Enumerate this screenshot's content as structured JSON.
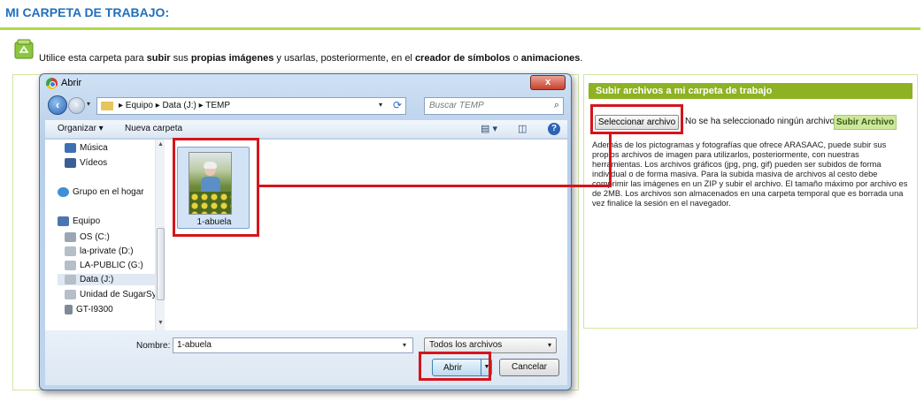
{
  "page": {
    "title": "MI CARPETA DE TRABAJO:",
    "intro": {
      "t1": "Utilice esta carpeta para ",
      "b1": "subir",
      "t2": " sus ",
      "b2": "propias imágenes",
      "t3": " y usarlas, posteriormente, en el ",
      "b3": "creador de símbolos",
      "t4": " o ",
      "b4": "animaciones",
      "t5": "."
    }
  },
  "upload_panel": {
    "header": "Subir archivos a mi carpeta de trabajo",
    "select_button": "Seleccionar archivo",
    "no_file_text": "No se ha seleccionado ningún archivo",
    "upload_button": "Subir Archivo",
    "description": "Además de los pictogramas y fotografías que ofrece ARASAAC, puede subir sus propios archivos de imagen para utilizarlos, posteriormente, con nuestras herramientas. Los archivos gráficos (jpg, png, gif) pueden ser subidos de forma individual o de forma masiva. Para la subida masiva de archivos al cesto debe comprimir las imágenes en un ZIP y subir el archivo. El tamaño máximo por archivo es de 2MB. Los archivos son almacenados en una carpeta temporal que es borrada una vez finalice la sesión en el navegador."
  },
  "dialog": {
    "title": "Abrir",
    "close_label": "x",
    "address": "▸ Equipo ▸ Data (J:) ▸ TEMP",
    "search_placeholder": "Buscar TEMP",
    "organize": "Organizar ▾",
    "new_folder": "Nueva carpeta",
    "nav_items": [
      {
        "label": "Música",
        "icon": "music-icon"
      },
      {
        "label": "Vídeos",
        "icon": "video-icon"
      },
      {
        "label": "Grupo en el hogar",
        "icon": "homegroup-icon"
      },
      {
        "label": "Equipo",
        "icon": "computer-icon"
      },
      {
        "label": "OS (C:)",
        "icon": "drive-icon"
      },
      {
        "label": "la-private (D:)",
        "icon": "drive-icon"
      },
      {
        "label": "LA-PUBLIC (G:)",
        "icon": "drive-icon"
      },
      {
        "label": "Data (J:)",
        "icon": "drive-icon"
      },
      {
        "label": "Unidad de SugarSync",
        "icon": "drive-icon"
      },
      {
        "label": "GT-I9300",
        "icon": "phone-icon"
      }
    ],
    "file": {
      "name": "1-abuela"
    },
    "filename_label": "Nombre:",
    "filename_value": "1-abuela",
    "filter": "Todos los archivos",
    "open_button": "Abrir",
    "cancel_button": "Cancelar"
  },
  "colors": {
    "title_blue": "#1f6fbf",
    "accent_green": "#8db224",
    "highlight_red": "#d4151c"
  }
}
